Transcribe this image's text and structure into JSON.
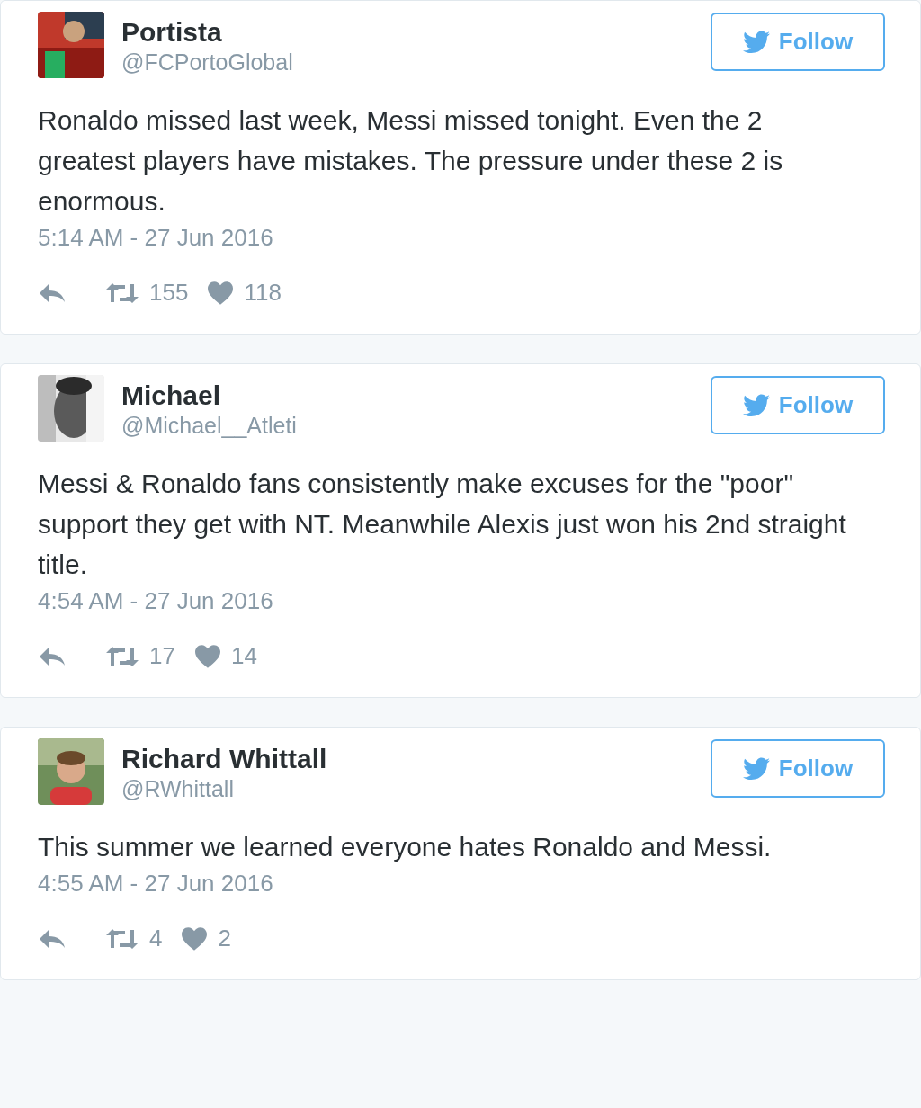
{
  "tweets": [
    {
      "name": "Portista",
      "handle": "@FCPortoGlobal",
      "follow": "Follow",
      "text": "Ronaldo missed last week, Messi missed tonight. Even the 2 greatest players have mistakes. The pressure under these 2 is enormous.",
      "time": "5:14 AM - 27 Jun 2016",
      "retweets": "155",
      "likes": "118"
    },
    {
      "name": "Michael",
      "handle": "@Michael__Atleti",
      "follow": "Follow",
      "text": "Messi & Ronaldo fans consistently make excuses for the \"poor\" support they get with NT. Meanwhile Alexis just won his 2nd straight title.",
      "time": "4:54 AM - 27 Jun 2016",
      "retweets": "17",
      "likes": "14"
    },
    {
      "name": "Richard Whittall",
      "handle": "@RWhittall",
      "follow": "Follow",
      "text": "This summer we learned everyone hates Ronaldo and Messi.",
      "time": "4:55 AM - 27 Jun 2016",
      "retweets": "4",
      "likes": "2"
    }
  ]
}
